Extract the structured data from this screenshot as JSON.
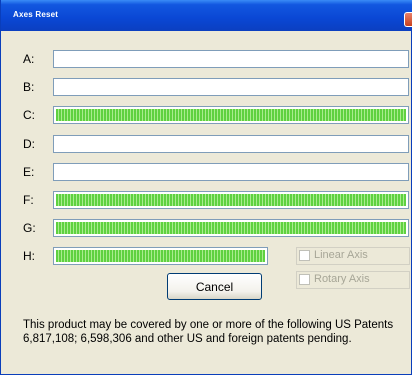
{
  "window": {
    "title": "Axes Reset"
  },
  "axes": [
    {
      "label": "A:",
      "progress": 0
    },
    {
      "label": "B:",
      "progress": 0
    },
    {
      "label": "C:",
      "progress": 1.0
    },
    {
      "label": "D:",
      "progress": 0
    },
    {
      "label": "E:",
      "progress": 0
    },
    {
      "label": "F:",
      "progress": 1.0
    },
    {
      "label": "G:",
      "progress": 1.0
    },
    {
      "label": "H:",
      "progress": 1.0
    }
  ],
  "options": {
    "linear_axis_label": "Linear Axis",
    "linear_axis_checked": false,
    "rotary_axis_label": "Rotary Axis",
    "rotary_axis_checked": false
  },
  "buttons": {
    "cancel_label": "Cancel"
  },
  "notice": {
    "text": "This product may be covered by one or more of the following US Patents 6,817,108; 6,598,306 and other US and foreign patents pending."
  },
  "colors": {
    "titlebar": "#0a47d4",
    "progress_fill": "#5fd140",
    "window_bg": "#ece9d8"
  }
}
